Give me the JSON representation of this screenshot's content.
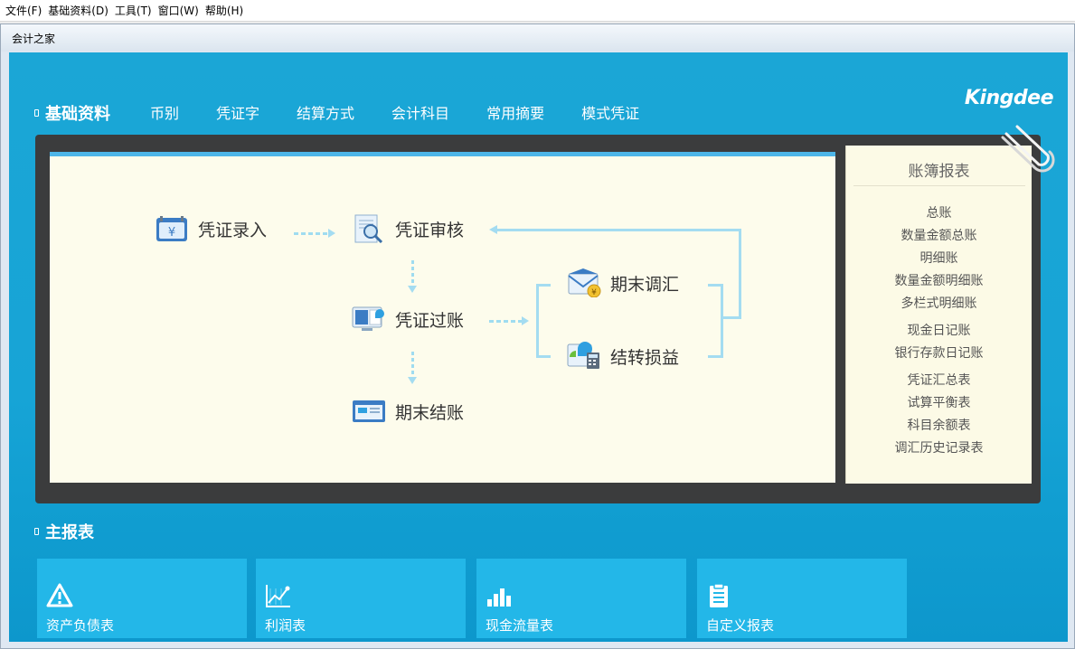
{
  "menubar": [
    {
      "label": "文件(F)"
    },
    {
      "label": "基础资料(D)"
    },
    {
      "label": "工具(T)"
    },
    {
      "label": "窗口(W)"
    },
    {
      "label": "帮助(H)"
    }
  ],
  "window": {
    "title": "会计之家"
  },
  "header": {
    "section_title": "基础资料",
    "tabs": [
      "币别",
      "凭证字",
      "结算方式",
      "会计科目",
      "常用摘要",
      "模式凭证"
    ],
    "logo": "Kingdee"
  },
  "flow": {
    "voucher_entry": "凭证录入",
    "voucher_audit": "凭证审核",
    "voucher_posting": "凭证过账",
    "period_close": "期末结账",
    "period_adjust": "期末调汇",
    "transfer_pl": "结转损益"
  },
  "ledger": {
    "title": "账簿报表",
    "items": [
      "总账",
      "数量金额总账",
      "明细账",
      "数量金额明细账",
      "多栏式明细账",
      "现金日记账",
      "银行存款日记账",
      "凭证汇总表",
      "试算平衡表",
      "科目余额表",
      "调汇历史记录表"
    ]
  },
  "reports": {
    "title": "主报表",
    "cards": [
      "资产负债表",
      "利润表",
      "现金流量表",
      "自定义报表"
    ]
  },
  "colors": {
    "stage_blue": "#17a4d6",
    "card_blue": "#23b7e8",
    "board": "#3b3c3d",
    "panel_cream": "#fdfcec",
    "connector": "#a4dcf1"
  }
}
